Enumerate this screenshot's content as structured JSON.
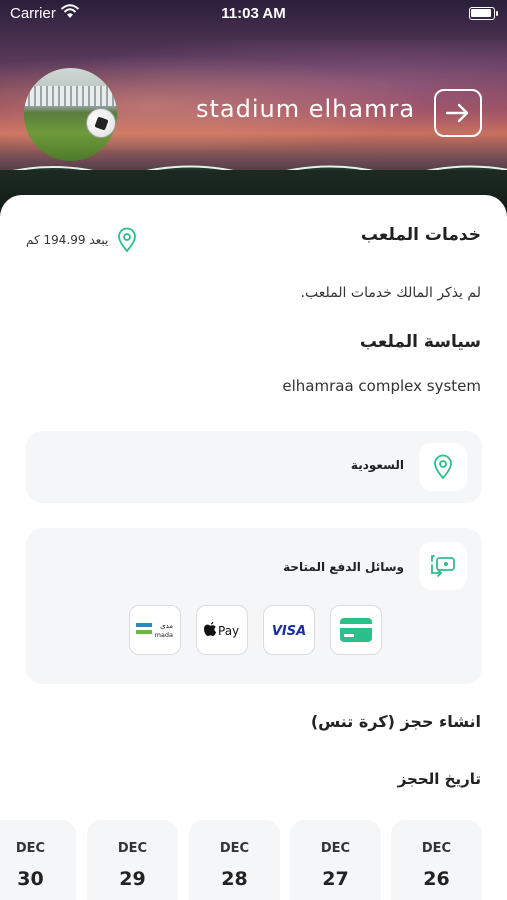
{
  "status_bar": {
    "carrier": "Carrier",
    "time": "11:03 AM"
  },
  "header": {
    "stadium_name": "stadium  elhamra"
  },
  "services": {
    "title": "خدمات الملعب",
    "distance": "يبعد 194.99 كم",
    "text": "لم يذكر المالك خدمات الملعب."
  },
  "policy": {
    "title": "سياسة  الملعب",
    "text": "elhamraa complex system"
  },
  "location_card": {
    "country": "السعودية"
  },
  "payment_card": {
    "title": "وسائل الدفع المتاحة",
    "methods": [
      "mada",
      "Apple Pay",
      "VISA",
      "card"
    ],
    "mada_top": "مدى",
    "mada_bottom": "mada",
    "applepay": "Pay",
    "visa": "VISA"
  },
  "booking": {
    "title": "انشاء حجز (كرة تنس)",
    "date_title": "تاريخ الحجز"
  },
  "dates": [
    {
      "month": "DEC",
      "day": "26"
    },
    {
      "month": "DEC",
      "day": "27"
    },
    {
      "month": "DEC",
      "day": "28"
    },
    {
      "month": "DEC",
      "day": "29"
    },
    {
      "month": "DEC",
      "day": "30"
    }
  ],
  "colors": {
    "accent": "#2bbf8a",
    "card_bg": "#f5f6f8"
  }
}
